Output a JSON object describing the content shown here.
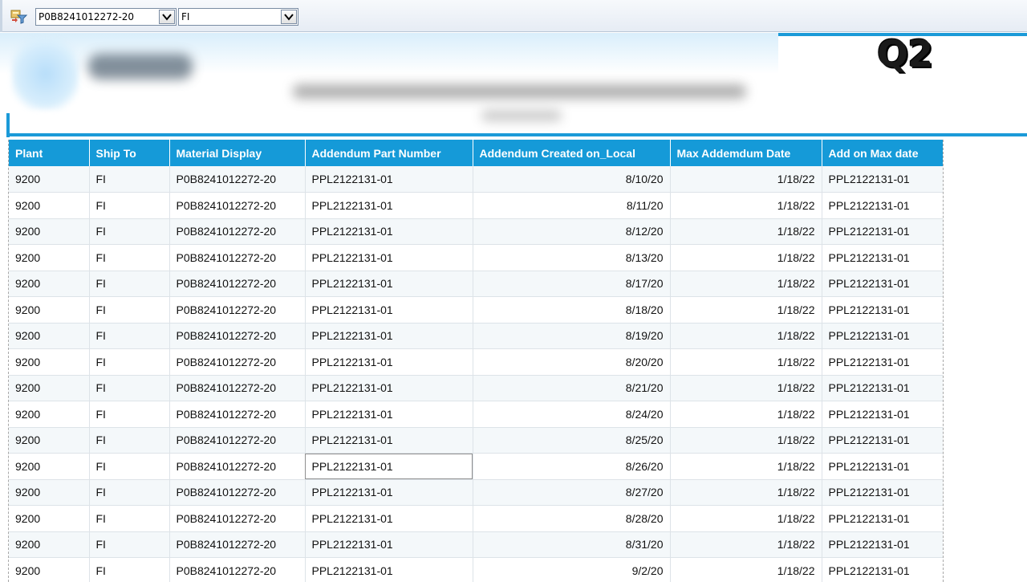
{
  "toolbar": {
    "filter1_value": "P0B8241012272-20",
    "filter2_value": "FI"
  },
  "banner": {
    "q_label": "Q2"
  },
  "table": {
    "headers": [
      "Plant",
      "Ship To",
      "Material Display",
      "Addendum Part Number",
      "Addendum Created on_Local",
      "Max Addemdum Date",
      "Add on Max date"
    ],
    "rows": [
      [
        "9200",
        "FI",
        "P0B8241012272-20",
        "PPL2122131-01",
        "8/10/20",
        "1/18/22",
        "PPL2122131-01"
      ],
      [
        "9200",
        "FI",
        "P0B8241012272-20",
        "PPL2122131-01",
        "8/11/20",
        "1/18/22",
        "PPL2122131-01"
      ],
      [
        "9200",
        "FI",
        "P0B8241012272-20",
        "PPL2122131-01",
        "8/12/20",
        "1/18/22",
        "PPL2122131-01"
      ],
      [
        "9200",
        "FI",
        "P0B8241012272-20",
        "PPL2122131-01",
        "8/13/20",
        "1/18/22",
        "PPL2122131-01"
      ],
      [
        "9200",
        "FI",
        "P0B8241012272-20",
        "PPL2122131-01",
        "8/17/20",
        "1/18/22",
        "PPL2122131-01"
      ],
      [
        "9200",
        "FI",
        "P0B8241012272-20",
        "PPL2122131-01",
        "8/18/20",
        "1/18/22",
        "PPL2122131-01"
      ],
      [
        "9200",
        "FI",
        "P0B8241012272-20",
        "PPL2122131-01",
        "8/19/20",
        "1/18/22",
        "PPL2122131-01"
      ],
      [
        "9200",
        "FI",
        "P0B8241012272-20",
        "PPL2122131-01",
        "8/20/20",
        "1/18/22",
        "PPL2122131-01"
      ],
      [
        "9200",
        "FI",
        "P0B8241012272-20",
        "PPL2122131-01",
        "8/21/20",
        "1/18/22",
        "PPL2122131-01"
      ],
      [
        "9200",
        "FI",
        "P0B8241012272-20",
        "PPL2122131-01",
        "8/24/20",
        "1/18/22",
        "PPL2122131-01"
      ],
      [
        "9200",
        "FI",
        "P0B8241012272-20",
        "PPL2122131-01",
        "8/25/20",
        "1/18/22",
        "PPL2122131-01"
      ],
      [
        "9200",
        "FI",
        "P0B8241012272-20",
        "PPL2122131-01",
        "8/26/20",
        "1/18/22",
        "PPL2122131-01"
      ],
      [
        "9200",
        "FI",
        "P0B8241012272-20",
        "PPL2122131-01",
        "8/27/20",
        "1/18/22",
        "PPL2122131-01"
      ],
      [
        "9200",
        "FI",
        "P0B8241012272-20",
        "PPL2122131-01",
        "8/28/20",
        "1/18/22",
        "PPL2122131-01"
      ],
      [
        "9200",
        "FI",
        "P0B8241012272-20",
        "PPL2122131-01",
        "8/31/20",
        "1/18/22",
        "PPL2122131-01"
      ],
      [
        "9200",
        "FI",
        "P0B8241012272-20",
        "PPL2122131-01",
        "9/2/20",
        "1/18/22",
        "PPL2122131-01"
      ]
    ]
  }
}
